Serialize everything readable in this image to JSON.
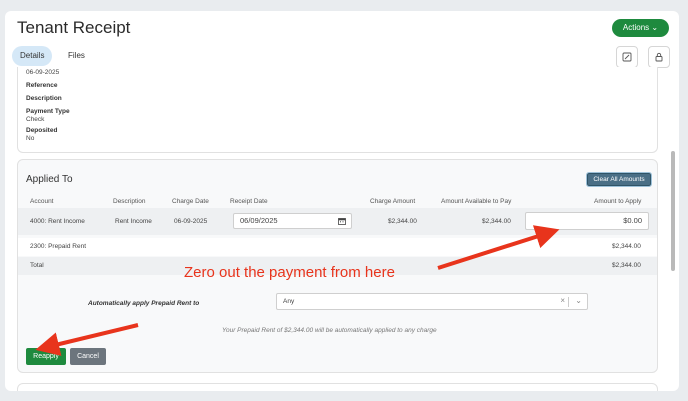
{
  "page": {
    "title": "Tenant Receipt",
    "actions_label": "Actions"
  },
  "tabs": [
    {
      "label": "Details"
    },
    {
      "label": "Files"
    }
  ],
  "details": {
    "date_value": "06-09-2025",
    "reference_label": "Reference",
    "description_label": "Description",
    "payment_type_label": "Payment Type",
    "payment_type_value": "Check",
    "deposited_label": "Deposited",
    "deposited_value": "No"
  },
  "applied_to": {
    "title": "Applied To",
    "clear_all_label": "Clear All Amounts",
    "columns": [
      "Account",
      "Description",
      "Charge Date",
      "Receipt Date",
      "Charge Amount",
      "Amount Available to Pay",
      "Amount to Apply"
    ],
    "row": {
      "account": "4000: Rent Income",
      "description": "Rent Income",
      "charge_date": "06-09-2025",
      "receipt_date": "06/09/2025",
      "charge_amount": "$2,344.00",
      "available": "$2,344.00",
      "amount_to_apply": "$0.00"
    },
    "prepaid_row": {
      "account": "2300: Prepaid Rent",
      "amount": "$2,344.00"
    },
    "total_row": {
      "label": "Total",
      "amount": "$2,344.00"
    }
  },
  "auto_apply": {
    "label": "Automatically apply Prepaid Rent to",
    "selected": "Any",
    "note": "Your Prepaid Rent of $2,344.00 will be automatically applied to any charge"
  },
  "buttons": {
    "reapply": "Reapply",
    "cancel": "Cancel"
  },
  "annotation": {
    "text": "Zero out the payment from here",
    "color": "#e8341c"
  },
  "colors": {
    "primary_green": "#1e8a3e",
    "tab_active": "#d5e8f7",
    "clear_btn": "#4a6f86"
  }
}
